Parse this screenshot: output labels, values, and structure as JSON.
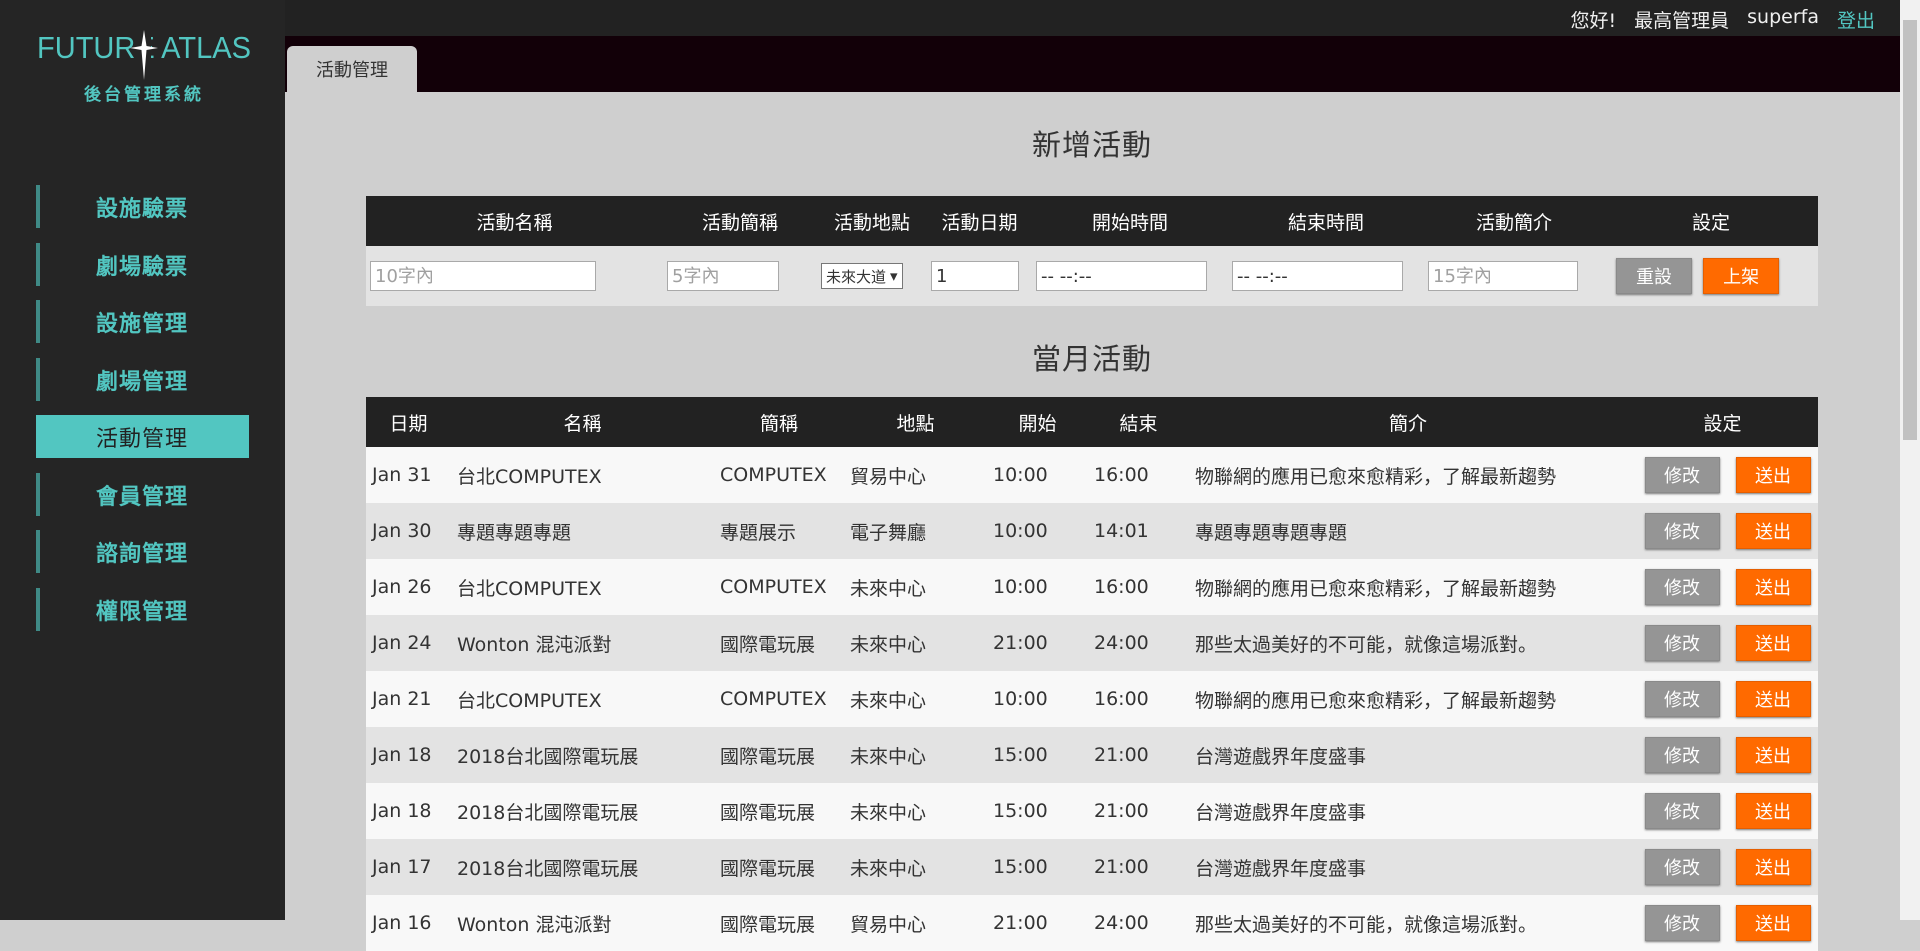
{
  "brand": {
    "logo_text": "FUTURE ATLAS",
    "subtitle": "後台管理系統"
  },
  "colors": {
    "accent": "#52c6c1",
    "orange": "#ff6a00",
    "gray_button": "#959595",
    "dark": "#222222"
  },
  "sidebar": {
    "items": [
      {
        "label": "設施驗票"
      },
      {
        "label": "劇場驗票"
      },
      {
        "label": "設施管理"
      },
      {
        "label": "劇場管理"
      },
      {
        "label": "活動管理",
        "active": true
      },
      {
        "label": "會員管理"
      },
      {
        "label": "諮詢管理"
      },
      {
        "label": "權限管理"
      }
    ]
  },
  "header": {
    "greeting": "您好!",
    "role": "最高管理員",
    "username": "superfa",
    "logout": "登出",
    "tab": "活動管理"
  },
  "new_event": {
    "title": "新增活動",
    "columns": [
      "活動名稱",
      "活動簡稱",
      "活動地點",
      "活動日期",
      "開始時間",
      "結束時間",
      "活動簡介",
      "設定"
    ],
    "name_placeholder": "10字內",
    "short_placeholder": "5字內",
    "location_selected": "未來大道",
    "date_value": "1",
    "start_value": "-- --:--",
    "end_value": "-- --:--",
    "intro_placeholder": "15字內",
    "reset_label": "重設",
    "publish_label": "上架"
  },
  "monthly": {
    "title": "當月活動",
    "columns": [
      "日期",
      "名稱",
      "簡稱",
      "地點",
      "開始",
      "結束",
      "簡介",
      "設定"
    ],
    "edit_label": "修改",
    "send_label": "送出",
    "rows": [
      {
        "date": "Jan 31",
        "name": "台北COMPUTEX",
        "short": "COMPUTEX",
        "location": "貿易中心",
        "start": "10:00",
        "end": "16:00",
        "intro": "物聯網的應用已愈來愈精彩，了解最新趨勢"
      },
      {
        "date": "Jan 30",
        "name": "專題專題專題",
        "short": "專題展示",
        "location": "電子舞廳",
        "start": "10:00",
        "end": "14:01",
        "intro": "專題專題專題專題"
      },
      {
        "date": "Jan 26",
        "name": "台北COMPUTEX",
        "short": "COMPUTEX",
        "location": "未來中心",
        "start": "10:00",
        "end": "16:00",
        "intro": "物聯網的應用已愈來愈精彩，了解最新趨勢"
      },
      {
        "date": "Jan 24",
        "name": "Wonton 混沌派對",
        "short": "國際電玩展",
        "location": "未來中心",
        "start": "21:00",
        "end": "24:00",
        "intro": "那些太過美好的不可能，就像這場派對。"
      },
      {
        "date": "Jan 21",
        "name": "台北COMPUTEX",
        "short": "COMPUTEX",
        "location": "未來中心",
        "start": "10:00",
        "end": "16:00",
        "intro": "物聯網的應用已愈來愈精彩，了解最新趨勢"
      },
      {
        "date": "Jan 18",
        "name": "2018台北國際電玩展",
        "short": "國際電玩展",
        "location": "未來中心",
        "start": "15:00",
        "end": "21:00",
        "intro": "台灣遊戲界年度盛事"
      },
      {
        "date": "Jan 18",
        "name": "2018台北國際電玩展",
        "short": "國際電玩展",
        "location": "未來中心",
        "start": "15:00",
        "end": "21:00",
        "intro": "台灣遊戲界年度盛事"
      },
      {
        "date": "Jan 17",
        "name": "2018台北國際電玩展",
        "short": "國際電玩展",
        "location": "未來中心",
        "start": "15:00",
        "end": "21:00",
        "intro": "台灣遊戲界年度盛事"
      },
      {
        "date": "Jan 16",
        "name": "Wonton 混沌派對",
        "short": "國際電玩展",
        "location": "貿易中心",
        "start": "21:00",
        "end": "24:00",
        "intro": "那些太過美好的不可能，就像這場派對。"
      }
    ]
  }
}
